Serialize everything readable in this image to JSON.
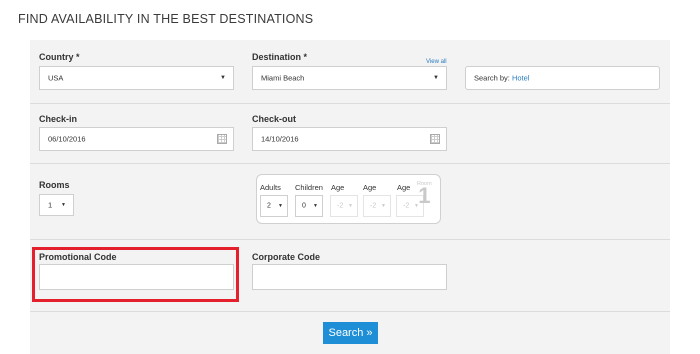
{
  "page_title": "FIND AVAILABILITY IN THE BEST DESTINATIONS",
  "form": {
    "country": {
      "label": "Country *",
      "value": "USA"
    },
    "destination": {
      "label": "Destination *",
      "value": "Miami Beach",
      "view_all": "View all"
    },
    "search_by": {
      "prefix": "Search by:",
      "value": "Hotel"
    },
    "checkin": {
      "label": "Check-in",
      "value": "06/10/2016"
    },
    "checkout": {
      "label": "Check-out",
      "value": "14/10/2016"
    },
    "rooms": {
      "label": "Rooms",
      "value": "1"
    },
    "occupancy": {
      "adults_label": "Adults",
      "children_label": "Children",
      "age_label": "Age",
      "adults_value": "2",
      "children_value": "0",
      "age_placeholder": "-2",
      "room_label": "Room",
      "room_number": "1"
    },
    "promo": {
      "label": "Promotional Code",
      "value": ""
    },
    "corporate": {
      "label": "Corporate Code",
      "value": ""
    },
    "search_button": "Search »"
  },
  "colors": {
    "link": "#2a7bbf",
    "button": "#1e8fd6",
    "highlight": "#e3202b",
    "panel": "#f3f3f3"
  }
}
